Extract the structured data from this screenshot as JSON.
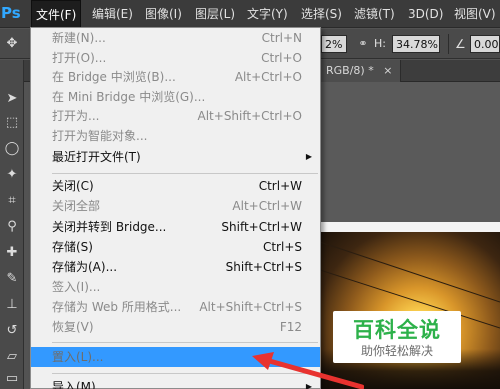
{
  "app": {
    "logo": "Ps"
  },
  "menubar": [
    {
      "label": "文件(F)",
      "active": true
    },
    {
      "label": "编辑(E)"
    },
    {
      "label": "图像(I)"
    },
    {
      "label": "图层(L)"
    },
    {
      "label": "文字(Y)"
    },
    {
      "label": "选择(S)"
    },
    {
      "label": "滤镜(T)"
    },
    {
      "label": "3D(D)"
    },
    {
      "label": "视图(V)"
    }
  ],
  "options": {
    "width_value": "2%",
    "height_label": "H:",
    "height_value": "34.78%",
    "angle_value": "0.00"
  },
  "document_tab": {
    "label": "RGB/8) *",
    "close": "×"
  },
  "file_menu": {
    "items": [
      {
        "label": "新建(N)...",
        "shortcut": "Ctrl+N",
        "state": "disabled"
      },
      {
        "label": "打开(O)...",
        "shortcut": "Ctrl+O",
        "state": "disabled"
      },
      {
        "label": "在 Bridge 中浏览(B)...",
        "shortcut": "Alt+Ctrl+O",
        "state": "disabled"
      },
      {
        "label": "在 Mini Bridge 中浏览(G)...",
        "shortcut": "",
        "state": "disabled"
      },
      {
        "label": "打开为...",
        "shortcut": "Alt+Shift+Ctrl+O",
        "state": "disabled"
      },
      {
        "label": "打开为智能对象...",
        "shortcut": "",
        "state": "disabled"
      },
      {
        "label": "最近打开文件(T)",
        "shortcut": "",
        "state": "enabled",
        "submenu": true
      },
      {
        "label": "关闭(C)",
        "shortcut": "Ctrl+W",
        "state": "enabled"
      },
      {
        "label": "关闭全部",
        "shortcut": "Alt+Ctrl+W",
        "state": "disabled"
      },
      {
        "label": "关闭并转到 Bridge...",
        "shortcut": "Shift+Ctrl+W",
        "state": "enabled"
      },
      {
        "label": "存储(S)",
        "shortcut": "Ctrl+S",
        "state": "enabled"
      },
      {
        "label": "存储为(A)...",
        "shortcut": "Shift+Ctrl+S",
        "state": "enabled"
      },
      {
        "label": "签入(I)...",
        "shortcut": "",
        "state": "disabled"
      },
      {
        "label": "存储为 Web 所用格式...",
        "shortcut": "Alt+Shift+Ctrl+S",
        "state": "disabled"
      },
      {
        "label": "恢复(V)",
        "shortcut": "F12",
        "state": "disabled"
      },
      {
        "label": "置入(L)...",
        "shortcut": "",
        "state": "highlight"
      },
      {
        "label": "导入(M)",
        "shortcut": "",
        "state": "enabled",
        "submenu": true
      }
    ]
  },
  "watermark": {
    "title": "百科全说",
    "subtitle": "助你轻松解决"
  },
  "colors": {
    "highlight": "#3399ff",
    "arrow": "#e8322f",
    "watermark_green": "#2db14a",
    "ps_blue": "#31a8ff"
  }
}
